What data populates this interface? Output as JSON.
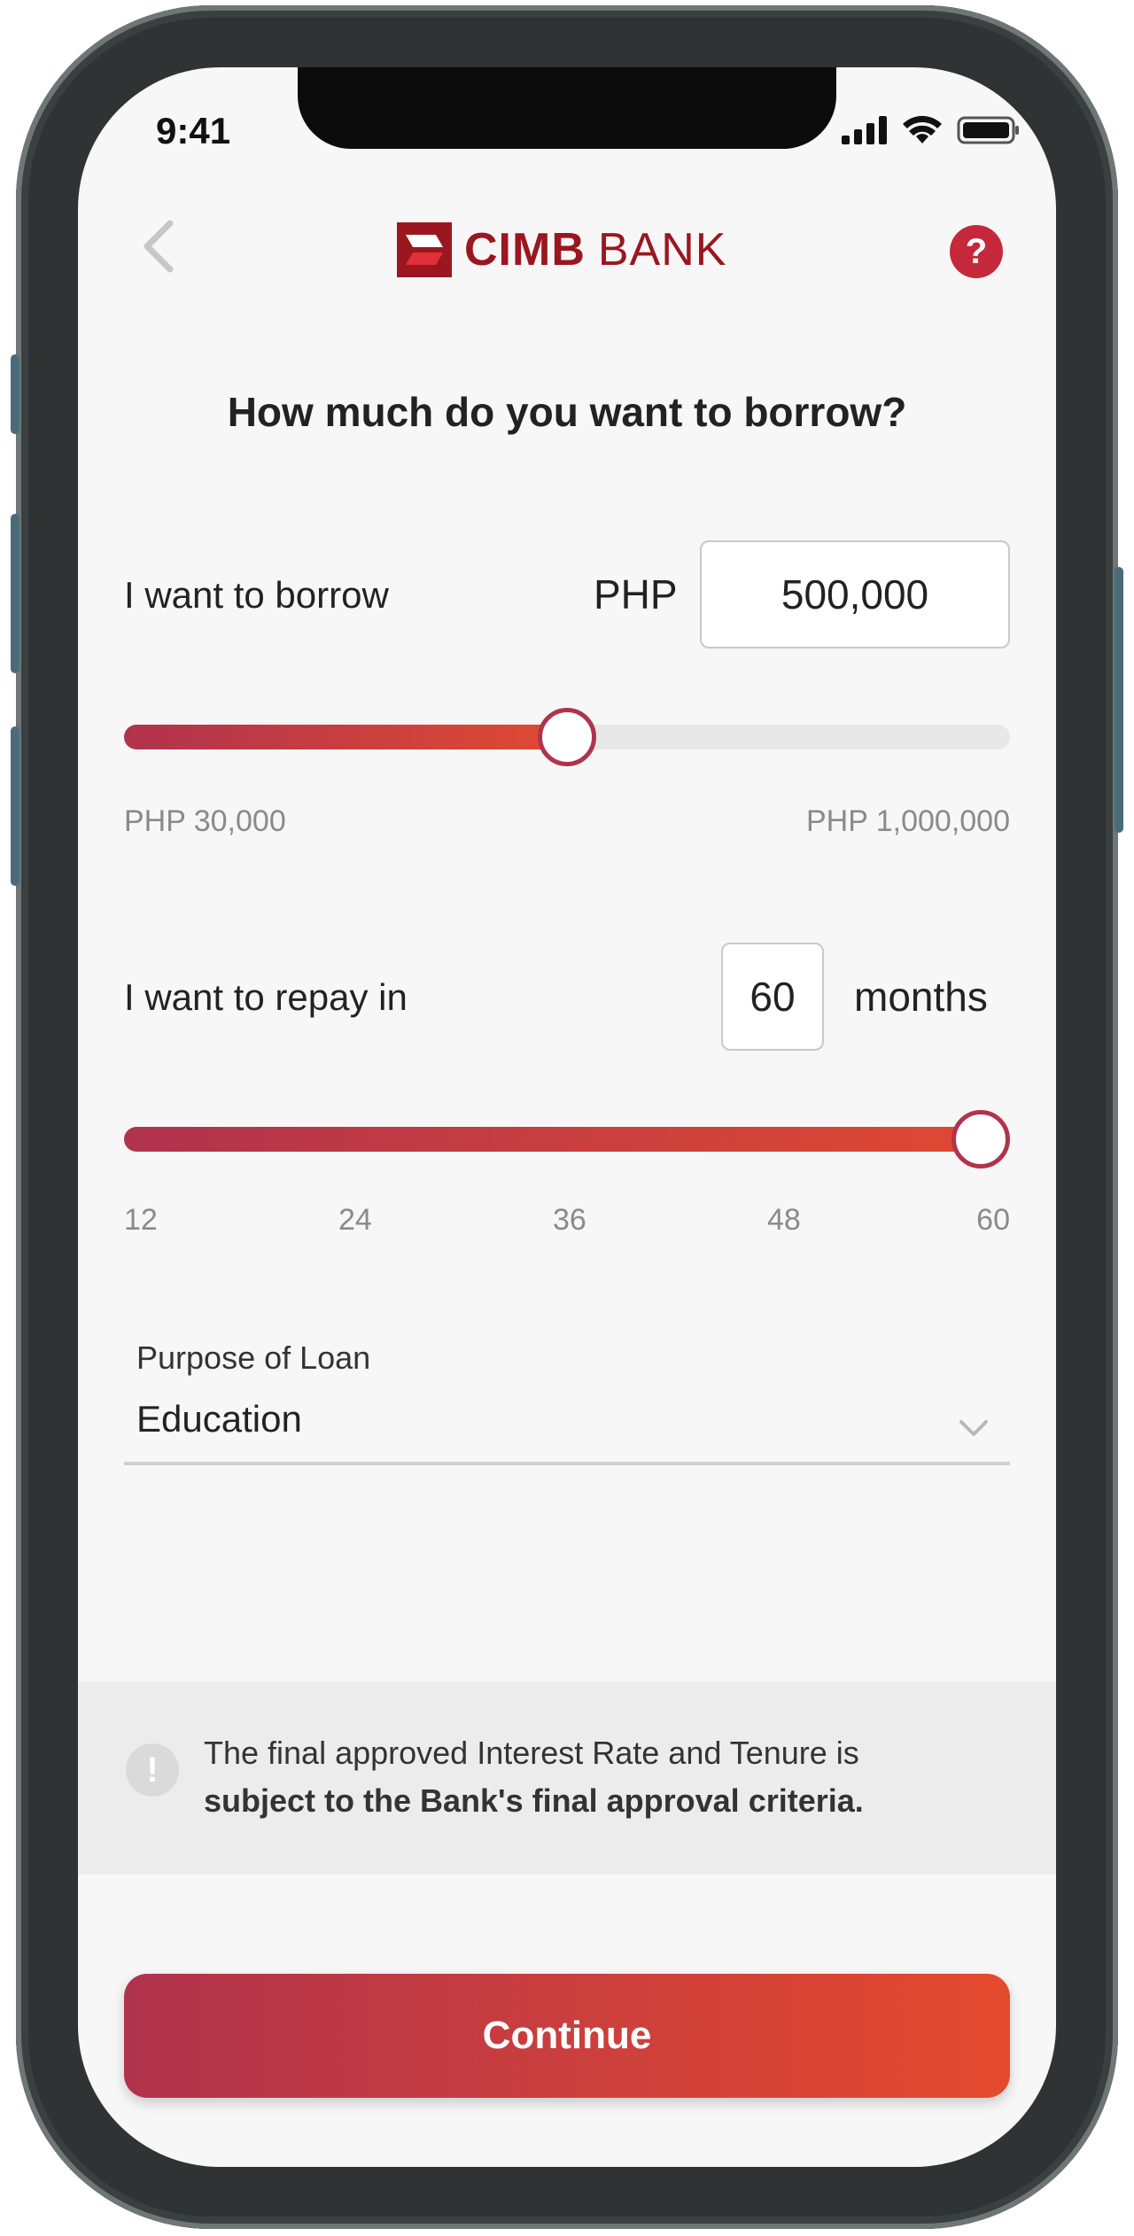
{
  "status": {
    "time": "9:41"
  },
  "header": {
    "logo_primary": "CIMB",
    "logo_secondary": "BANK",
    "help_glyph": "?"
  },
  "page": {
    "title": "How much do you want to borrow?"
  },
  "borrow": {
    "label": "I want to borrow",
    "currency": "PHP",
    "amount": "500,000",
    "min_label": "PHP 30,000",
    "max_label": "PHP 1,000,000",
    "slider_fraction": 0.5
  },
  "repay": {
    "label": "I want to repay in",
    "months": "60",
    "unit": "months",
    "ticks": [
      "12",
      "24",
      "36",
      "48",
      "60"
    ],
    "slider_fraction": 1.0
  },
  "purpose": {
    "label": "Purpose of Loan",
    "value": "Education"
  },
  "notice": {
    "icon_glyph": "!",
    "text": "The final approved Interest Rate and Tenure is",
    "bold_text": "subject to the Bank's final approval criteria."
  },
  "actions": {
    "continue_label": "Continue"
  },
  "colors": {
    "brand": "#9a1720",
    "accent_start": "#b0334d",
    "accent_end": "#e04a32"
  },
  "icons": [
    "signal-icon",
    "wifi-icon",
    "battery-icon",
    "back-chevron-icon",
    "help-icon",
    "chevron-down-icon",
    "info-icon"
  ]
}
